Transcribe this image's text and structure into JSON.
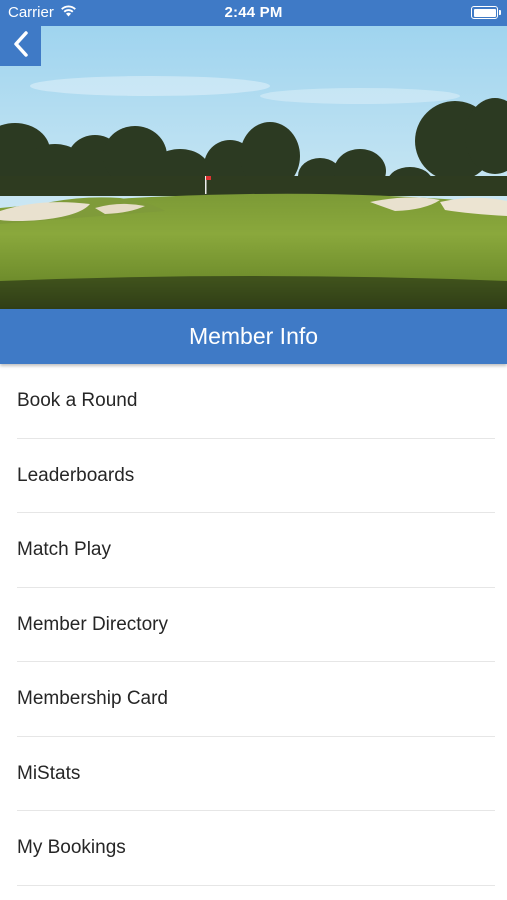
{
  "status_bar": {
    "carrier": "Carrier",
    "time": "2:44 PM",
    "icons": {
      "wifi": "wifi-icon",
      "battery": "battery-icon"
    }
  },
  "header": {
    "back_icon": "chevron-left-icon",
    "title": "Member Info"
  },
  "menu": {
    "items": [
      {
        "label": "Book a Round"
      },
      {
        "label": "Leaderboards"
      },
      {
        "label": "Match Play"
      },
      {
        "label": "Member Directory"
      },
      {
        "label": "Membership Card"
      },
      {
        "label": "MiStats"
      },
      {
        "label": "My Bookings"
      }
    ]
  },
  "colors": {
    "accent": "#3f7ac6",
    "background": "#ffffff",
    "text": "#262626",
    "divider": "#e6e6e6"
  }
}
